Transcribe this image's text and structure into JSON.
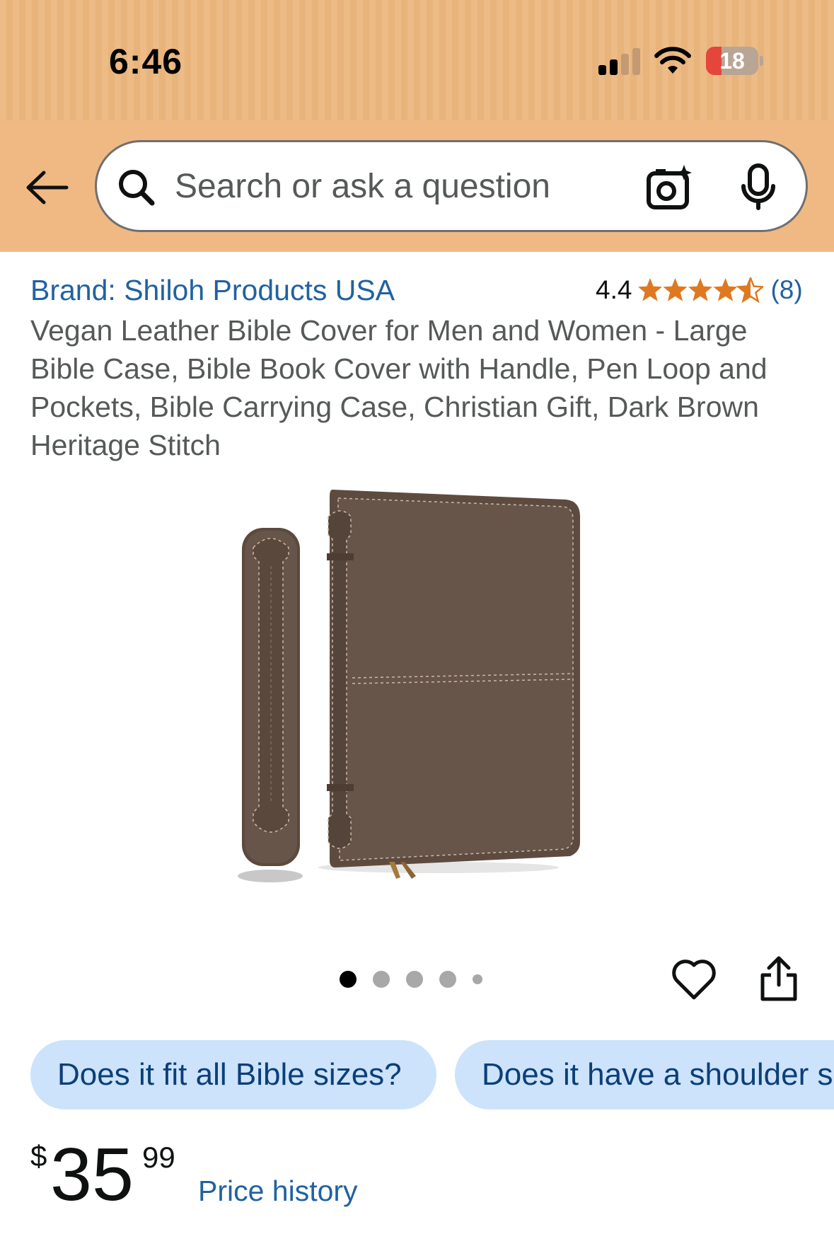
{
  "status_bar": {
    "time": "6:46",
    "battery_level": "18",
    "signal_bars_active": 2,
    "signal_bars_total": 4
  },
  "header": {
    "background_color": "#ecbb86",
    "back_icon": "arrow-left-icon",
    "search": {
      "placeholder": "Search or ask a question",
      "value": "",
      "camera_icon": "camera-sparkle-icon",
      "mic_icon": "microphone-icon"
    }
  },
  "product": {
    "brand": "Brand: Shiloh Products USA",
    "rating": {
      "value": "4.4",
      "stars": 4.5,
      "max_stars": 5,
      "count": "(8)"
    },
    "title": "Vegan Leather Bible Cover for Men and Women - Large Bible Case, Bible Book Cover with Handle, Pen Loop and Pockets, Bible Carrying Case, Christian Gift, Dark Brown Heritage Stitch",
    "image": {
      "icon": "bible-cover-product-image",
      "total_images": 5,
      "active_index": 0
    },
    "actions": {
      "favorite_icon": "heart-icon",
      "share_icon": "share-icon"
    }
  },
  "questions": [
    "Does it fit all Bible sizes?",
    "Does it have a shoulder s"
  ],
  "price": {
    "symbol": "$",
    "whole": "35",
    "fraction": "99",
    "history_link": "Price history"
  },
  "colors": {
    "link": "#2162a1",
    "star": "#de7921",
    "chip_bg": "#cde3fb",
    "chip_text": "#0b3f78"
  }
}
